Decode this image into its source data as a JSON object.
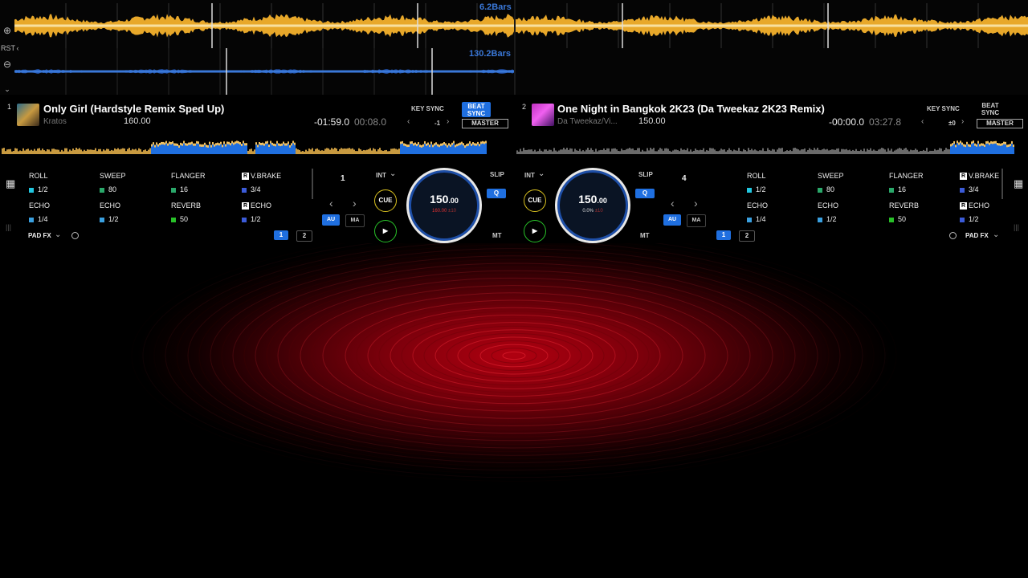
{
  "waveform": {
    "deck1_bars": "6.2Bars",
    "deck2_bars": "130.2Bars",
    "side_buttons": [
      "⊕",
      "RST",
      "⊖",
      "‹",
      "⌄"
    ]
  },
  "deck1": {
    "number": "1",
    "title": "Only Girl (Hardstyle Remix Sped Up)",
    "artist": "Kratos",
    "bpm": "160.00",
    "time_remaining": "-01:59.0",
    "time_total": "00:08.0",
    "key_sync": "KEY SYNC",
    "key_left": "‹",
    "key_value": "-1",
    "key_right": "›",
    "beat_sync": "BEAT SYNC",
    "master": "MASTER",
    "fx": [
      {
        "name": "ROLL",
        "value": "1/2",
        "color": "#22c7e0",
        "badge": false
      },
      {
        "name": "SWEEP",
        "value": "80",
        "color": "#2aa86a",
        "badge": false
      },
      {
        "name": "FLANGER",
        "value": "16",
        "color": "#2aa86a",
        "badge": false
      },
      {
        "name": "V.BRAKE",
        "value": "3/4",
        "color": "#3b5bd9",
        "badge": true
      },
      {
        "name": "ECHO",
        "value": "1/4",
        "color": "#3aa0e0",
        "badge": false
      },
      {
        "name": "ECHO",
        "value": "1/2",
        "color": "#3aa0e0",
        "badge": false
      },
      {
        "name": "REVERB",
        "value": "50",
        "color": "#28c028",
        "badge": false
      },
      {
        "name": "ECHO",
        "value": "1/2",
        "color": "#3b5bd9",
        "badge": true
      }
    ],
    "pad_fx": "PAD FX",
    "pad_pages": [
      "1",
      "2"
    ],
    "loop_value": "1",
    "loop_prev": "‹",
    "loop_next": "›",
    "au": "AU",
    "ma": "MA",
    "int": "INT",
    "cue": "CUE",
    "play": "▶",
    "slip": "SLIP",
    "q": "Q",
    "mt": "MT",
    "jog_bpm": "150",
    "jog_bpm_dec": ".00",
    "jog_pitch": "160.00",
    "jog_range": "±10"
  },
  "deck2": {
    "number": "2",
    "title": "One Night in Bangkok 2K23 (Da Tweekaz 2K23 Remix)",
    "artist": "Da Tweekaz/Vi...",
    "bpm": "150.00",
    "time_remaining": "-00:00.0",
    "time_total": "03:27.8",
    "key_sync": "KEY SYNC",
    "key_left": "‹",
    "key_value": "±0",
    "key_right": "›",
    "beat_sync": "BEAT SYNC",
    "master": "MASTER",
    "fx": [
      {
        "name": "ROLL",
        "value": "1/2",
        "color": "#22c7e0",
        "badge": false
      },
      {
        "name": "SWEEP",
        "value": "80",
        "color": "#2aa86a",
        "badge": false
      },
      {
        "name": "FLANGER",
        "value": "16",
        "color": "#2aa86a",
        "badge": false
      },
      {
        "name": "V.BRAKE",
        "value": "3/4",
        "color": "#3b5bd9",
        "badge": true
      },
      {
        "name": "ECHO",
        "value": "1/4",
        "color": "#3aa0e0",
        "badge": false
      },
      {
        "name": "ECHO",
        "value": "1/2",
        "color": "#3aa0e0",
        "badge": false
      },
      {
        "name": "REVERB",
        "value": "50",
        "color": "#28c028",
        "badge": false
      },
      {
        "name": "ECHO",
        "value": "1/2",
        "color": "#3b5bd9",
        "badge": true
      }
    ],
    "pad_fx": "PAD FX",
    "pad_pages": [
      "1",
      "2"
    ],
    "loop_value": "4",
    "loop_prev": "‹",
    "loop_next": "›",
    "au": "AU",
    "ma": "MA",
    "int": "INT",
    "cue": "CUE",
    "play": "▶",
    "slip": "SLIP",
    "q": "Q",
    "mt": "MT",
    "jog_bpm": "150",
    "jog_bpm_dec": ".00",
    "jog_pitch": "0.0%",
    "jog_range": "±10"
  },
  "colors": {
    "accent_blue": "#1f6fe0",
    "waveform_gold": "#e8a82a",
    "cue_yellow": "#d8c020",
    "play_green": "#28c028"
  }
}
